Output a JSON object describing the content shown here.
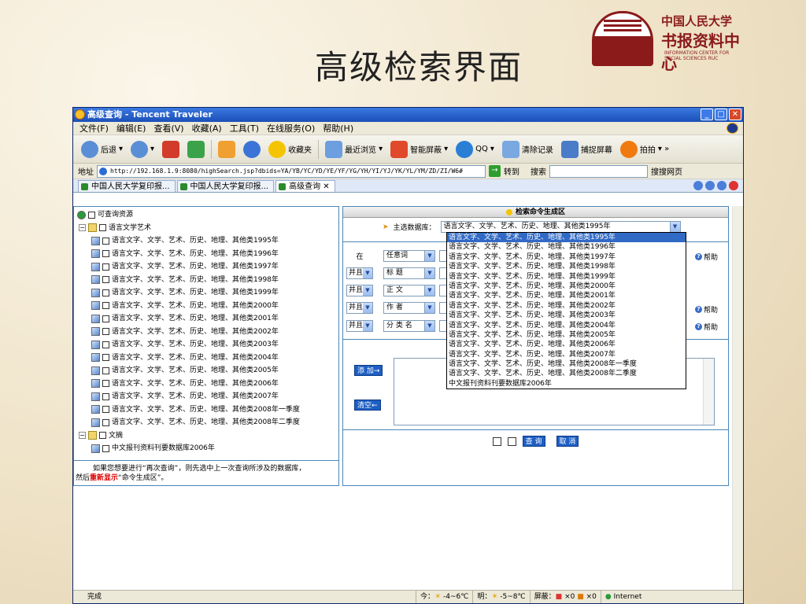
{
  "slide_title": "高级检索界面",
  "logo": {
    "cn1": "中国人民大学",
    "cn2": "书报资料中心",
    "en1": "INFORMATION CENTER FOR",
    "en2": "SOCIAL SCIENCES RUC"
  },
  "window": {
    "title": "高级查询 - Tencent Traveler"
  },
  "menu": [
    "文件(F)",
    "编辑(E)",
    "查看(V)",
    "收藏(A)",
    "工具(T)",
    "在线服务(O)",
    "帮助(H)"
  ],
  "toolbar": {
    "back": "后退",
    "favorites": "收藏夹",
    "history": "最近浏览",
    "block": "智能屏蔽",
    "qq": "QQ",
    "clear": "清除记录",
    "capture": "捕捉屏幕",
    "paipai": "拍拍"
  },
  "address": {
    "label": "地址",
    "url": "http://192.168.1.9:8080/highSearch.jsp?dbids=YA/YB/YC/YD/YE/YF/YG/YH/YI/YJ/YK/YL/YM/ZD/ZI/W6#",
    "go": "转到",
    "search_label": "搜索",
    "search_engine": "搜搜网页"
  },
  "tabs": [
    "中国人民大学复印报...",
    "中国人民大学复印报...",
    "高级查询"
  ],
  "tree": {
    "root": "可查询资源",
    "group1": "语言文学艺术",
    "items": [
      "语言文字、文学、艺术、历史、地理、其他类1995年",
      "语言文字、文学、艺术、历史、地理、其他类1996年",
      "语言文字、文学、艺术、历史、地理、其他类1997年",
      "语言文字、文学、艺术、历史、地理、其他类1998年",
      "语言文字、文学、艺术、历史、地理、其他类1999年",
      "语言文字、文学、艺术、历史、地理、其他类2000年",
      "语言文字、文学、艺术、历史、地理、其他类2001年",
      "语言文字、文学、艺术、历史、地理、其他类2002年",
      "语言文字、文学、艺术、历史、地理、其他类2003年",
      "语言文字、文学、艺术、历史、地理、其他类2004年",
      "语言文字、文学、艺术、历史、地理、其他类2005年",
      "语言文字、文学、艺术、历史、地理、其他类2006年",
      "语言文字、文学、艺术、历史、地理、其他类2007年",
      "语言文字、文学、艺术、历史、地理、其他类2008年一季度",
      "语言文字、文学、艺术、历史、地理、其他类2008年二季度"
    ],
    "group2": "文摘",
    "group2_item": "中文报刊资料刊要数据库2006年"
  },
  "note": {
    "line1": "如果您想要进行“再次查询”，则先选中上一次查询所涉及的数据库，",
    "line2_prefix": "然后",
    "line2_red": "重新显示",
    "line2_suffix": "“命令生成区”。"
  },
  "panel": {
    "header": "检索命令生成区",
    "db_label": "主选数据库：",
    "db_selected": "语言文字、文学、艺术、历史、地理、其他类1995年",
    "dropdown": [
      "语言文字、文学、艺术、历史、地理、其他类1995年",
      "语言文字、文学、艺术、历史、地理、其他类1996年",
      "语言文字、文学、艺术、历史、地理、其他类1997年",
      "语言文字、文学、艺术、历史、地理、其他类1998年",
      "语言文字、文学、艺术、历史、地理、其他类1999年",
      "语言文字、文学、艺术、历史、地理、其他类2000年",
      "语言文字、文学、艺术、历史、地理、其他类2001年",
      "语言文字、文学、艺术、历史、地理、其他类2002年",
      "语言文字、文学、艺术、历史、地理、其他类2003年",
      "语言文字、文学、艺术、历史、地理、其他类2004年",
      "语言文字、文学、艺术、历史、地理、其他类2005年",
      "语言文字、文学、艺术、历史、地理、其他类2006年",
      "语言文字、文学、艺术、历史、地理、其他类2007年",
      "语言文字、文学、艺术、历史、地理、其他类2008年一季度",
      "语言文字、文学、艺术、历史、地理、其他类2008年二季度",
      "中文报刊资料刊要数据库2006年"
    ],
    "rows": [
      {
        "op": "在",
        "field": "任意词"
      },
      {
        "op": "并且",
        "field": "标 题"
      },
      {
        "op": "并且",
        "field": "正 文"
      },
      {
        "op": "并且",
        "field": "作 者"
      },
      {
        "op": "并且",
        "field": "分 类 名"
      }
    ],
    "help": "帮助",
    "add": "添 加→",
    "clear": "清空←",
    "query": "查 询",
    "cancel": "取 消"
  },
  "status": {
    "done": "完成",
    "today": "今：",
    "today_temp": "-4~6℃",
    "tomorrow": "明：",
    "tomorrow_temp": "-5~8℃",
    "block_label": "屏蔽：",
    "count1": "×0",
    "count2": "×0",
    "zone": "Internet"
  }
}
